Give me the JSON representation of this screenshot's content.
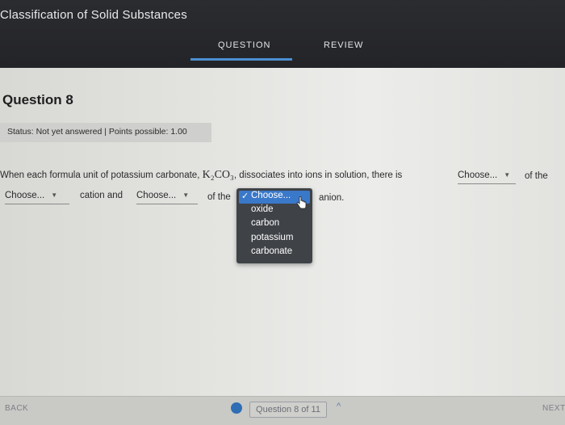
{
  "app": {
    "title": "Classification of Solid Substances"
  },
  "tabs": [
    {
      "label": "QUESTION",
      "active": true
    },
    {
      "label": "REVIEW",
      "active": false
    }
  ],
  "question": {
    "title": "Question 8",
    "status": "Status: Not yet answered | Points possible: 1.00",
    "line1_prefix": "When each formula unit of potassium carbonate, ",
    "formula": "K₂CO₃",
    "line1_suffix": ", dissociates into ions in solution, there is",
    "after_dd1": "of the",
    "between_dd2_dd3": "cation and",
    "after_dd3": "of the",
    "after_dd4": "anion.",
    "dropdowns": [
      {
        "value": "Choose..."
      },
      {
        "value": "Choose..."
      },
      {
        "value": "Choose..."
      },
      {
        "value": "Choose..."
      }
    ],
    "open_dropdown_options": [
      "Choose...",
      "oxide",
      "carbon",
      "potassium",
      "carbonate"
    ]
  },
  "footer": {
    "back_label": "BACK",
    "next_label": "NEXT",
    "counter": "Question 8 of 11"
  },
  "colors": {
    "accent": "#3a78c9",
    "topbar": "#2b2c30"
  }
}
